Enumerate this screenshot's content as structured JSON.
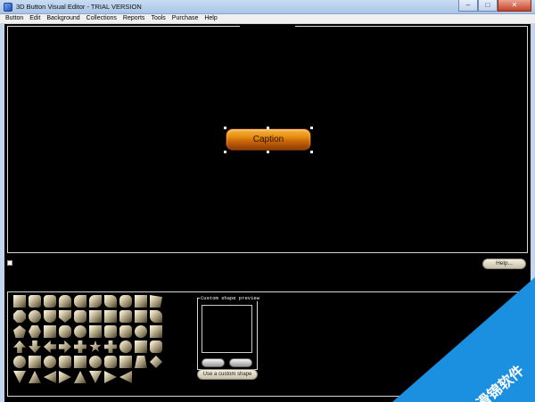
{
  "window": {
    "title": "3D Button Visual Editor - TRIAL VERSION",
    "controls": {
      "minimize": "–",
      "maximize": "□",
      "close": "✕"
    }
  },
  "menu": {
    "items": [
      {
        "label": "Button"
      },
      {
        "label": "Edit"
      },
      {
        "label": "Background"
      },
      {
        "label": "Collections"
      },
      {
        "label": "Reports"
      },
      {
        "label": "Tools"
      },
      {
        "label": "Purchase"
      },
      {
        "label": "Help"
      }
    ]
  },
  "canvas": {
    "button_caption": "Caption",
    "button_color": "#e9910f"
  },
  "help_button": {
    "label": "Help..."
  },
  "custom_shape": {
    "preview_label": "Custom shape preview",
    "use_button": "Use a custom shape"
  },
  "watermark": {
    "text": "滑锦软件"
  },
  "colors": {
    "background": "#000000",
    "accent": "#1b8fe0"
  }
}
